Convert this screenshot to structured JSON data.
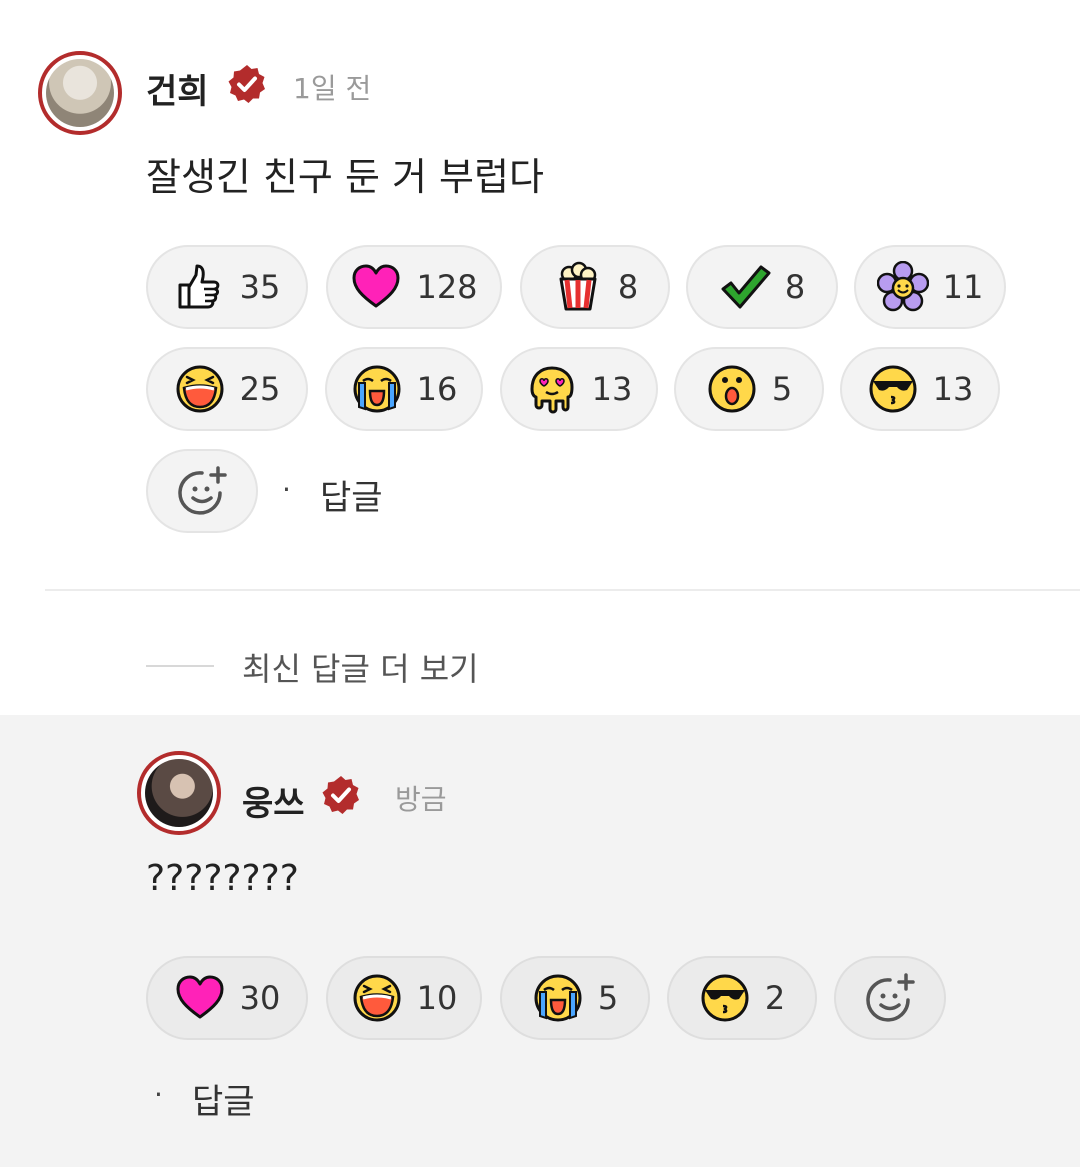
{
  "comment": {
    "author": "건희",
    "time": "1일 전",
    "text": "잘생긴 친구 둔 거 부럽다",
    "reactions": [
      {
        "icon": "thumbs-up-icon",
        "count": "35"
      },
      {
        "icon": "heart-icon",
        "count": "128"
      },
      {
        "icon": "popcorn-icon",
        "count": "8"
      },
      {
        "icon": "checkmark-icon",
        "count": "8"
      },
      {
        "icon": "flower-icon",
        "count": "11"
      },
      {
        "icon": "laughing-face-icon",
        "count": "25"
      },
      {
        "icon": "crying-face-icon",
        "count": "16"
      },
      {
        "icon": "melting-heart-eyes-icon",
        "count": "13"
      },
      {
        "icon": "surprised-face-icon",
        "count": "5"
      },
      {
        "icon": "sunglasses-kiss-icon",
        "count": "13"
      }
    ],
    "reply_label": "답글"
  },
  "more_replies_label": "최신 답글 더 보기",
  "reply": {
    "author": "웅쓰",
    "time": "방금",
    "text": "????????",
    "reactions": [
      {
        "icon": "heart-icon",
        "count": "30"
      },
      {
        "icon": "laughing-face-icon",
        "count": "10"
      },
      {
        "icon": "crying-face-icon",
        "count": "5"
      },
      {
        "icon": "sunglasses-kiss-icon",
        "count": "2"
      }
    ],
    "reply_label": "답글"
  },
  "colors": {
    "accent": "#b32c2c",
    "heart": "#ff22b8",
    "emoji_yellow": "#ffd84a",
    "check": "#2ea52e",
    "flower": "#b89cf0"
  }
}
